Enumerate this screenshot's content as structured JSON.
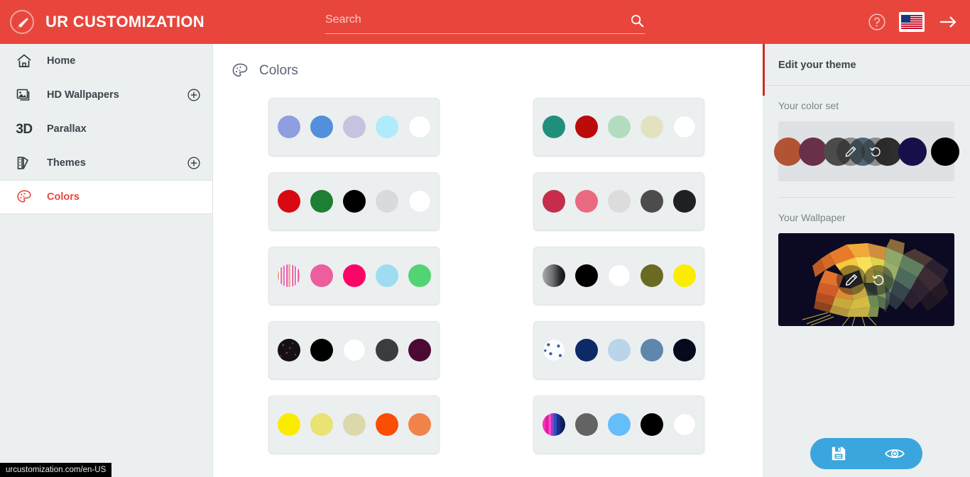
{
  "header": {
    "brand_title": "UR CUSTOMIZATION",
    "logo_icon": "paintbrush-circle-icon",
    "search": {
      "placeholder": "Search",
      "value": "",
      "icon": "search-icon"
    },
    "help_icon": "help-circle-icon",
    "language_flag": "us-flag-icon",
    "forward_icon": "arrow-right-icon",
    "bg_color": "#e8463c"
  },
  "sidebar": {
    "items": [
      {
        "label": "Home",
        "icon": "home-icon",
        "has_add": false,
        "active": false
      },
      {
        "label": "HD Wallpapers",
        "icon": "image-stack-icon",
        "has_add": true,
        "active": false
      },
      {
        "label": "Parallax",
        "icon": "3d-text-icon",
        "has_add": false,
        "active": false
      },
      {
        "label": "Themes",
        "icon": "theme-swatch-icon",
        "has_add": true,
        "active": false
      },
      {
        "label": "Colors",
        "icon": "color-palette-icon",
        "has_add": false,
        "active": true
      }
    ],
    "add_icon": "plus-circle-icon",
    "bg_color": "#eceff0"
  },
  "main": {
    "title": "Colors",
    "title_icon": "color-palette-icon",
    "palettes": [
      {
        "name": "palette-1",
        "colors": [
          "#8f9ee0",
          "#5290dd",
          "#c4c3e0",
          "#b0ebfb",
          "#ffffff"
        ]
      },
      {
        "name": "palette-2",
        "colors": [
          "#20907c",
          "#bb0b0b",
          "#b3dcbe",
          "#e3e2c0",
          "#ffffff"
        ]
      },
      {
        "name": "palette-3",
        "colors": [
          "#da0812",
          "#1d7f33",
          "#000000",
          "#d9dadb",
          "#ffffff"
        ]
      },
      {
        "name": "palette-4",
        "colors": [
          "#c62d4c",
          "#ea6b81",
          "#dcdcdc",
          "#4c4c4c",
          "#1e2022"
        ]
      },
      {
        "name": "palette-5",
        "colors": [
          "stripes-pink",
          "#ed5e9c",
          "#fc0466",
          "#9fdcf0",
          "#52d472"
        ]
      },
      {
        "name": "palette-6",
        "colors": [
          "gradient-grey",
          "#000000",
          "#ffffff",
          "#6b6a22",
          "#fbec00"
        ]
      },
      {
        "name": "palette-7",
        "colors": [
          "speckled-dark",
          "#000000",
          "#ffffff",
          "#3a3c3e",
          "#4c0933"
        ]
      },
      {
        "name": "palette-8",
        "colors": [
          "anchor-pattern",
          "#0d2a67",
          "#bad5ea",
          "#5f87ad",
          "#050a1c"
        ]
      },
      {
        "name": "palette-9",
        "colors": [
          "#fbeb00",
          "#e8e373",
          "#dcd8ac",
          "#fa4e05",
          "#f1834a"
        ]
      },
      {
        "name": "palette-10",
        "colors": [
          "stripes-magenta",
          "#636363",
          "#63befa",
          "#000000",
          "#ffffff"
        ]
      }
    ]
  },
  "right_panel": {
    "title": "Edit your theme",
    "color_set_label": "Your color set",
    "color_set": [
      "#b05434",
      "#693049",
      "#4b4b4b",
      "#516773",
      "#2e2e2e",
      "#16104a",
      "#000000"
    ],
    "color_set_edit_icon": "pencil-icon",
    "color_set_reset_icon": "undo-icon",
    "wallpaper_label": "Your Wallpaper",
    "wallpaper_alt": "low-poly tiger wallpaper",
    "wallpaper_edit_icon": "pencil-icon",
    "wallpaper_reset_icon": "undo-icon",
    "actions": {
      "save_icon": "save-floppy-icon",
      "preview_icon": "eye-icon",
      "bg_color": "#3ba5dd"
    }
  },
  "status_bar": {
    "url": "urcustomization.com/en-US"
  }
}
